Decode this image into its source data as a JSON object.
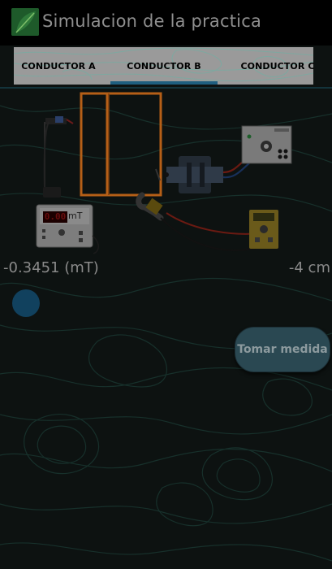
{
  "app": {
    "title": "Simulacion de la practica"
  },
  "tabs": [
    {
      "label": "CONDUCTOR A",
      "selected": false
    },
    {
      "label": "CONDUCTOR B",
      "selected": true
    },
    {
      "label": "CONDUCTOR C",
      "selected": false
    }
  ],
  "readings": {
    "field": "-0.3451 (mT)",
    "distance": "-4 cm"
  },
  "gaussmeter": {
    "display": "0.00",
    "unit": "mT"
  },
  "actions": {
    "measure_label": "Tomar medida"
  },
  "colors": {
    "actionbar": "#000000",
    "background": "#0d1211",
    "tab_indicator": "#1f5f80",
    "conductor": "#c0661a",
    "button": "#2a4852"
  },
  "icons": {
    "app_logo": "leaf-logo-icon",
    "action_dot": "circle-icon"
  }
}
